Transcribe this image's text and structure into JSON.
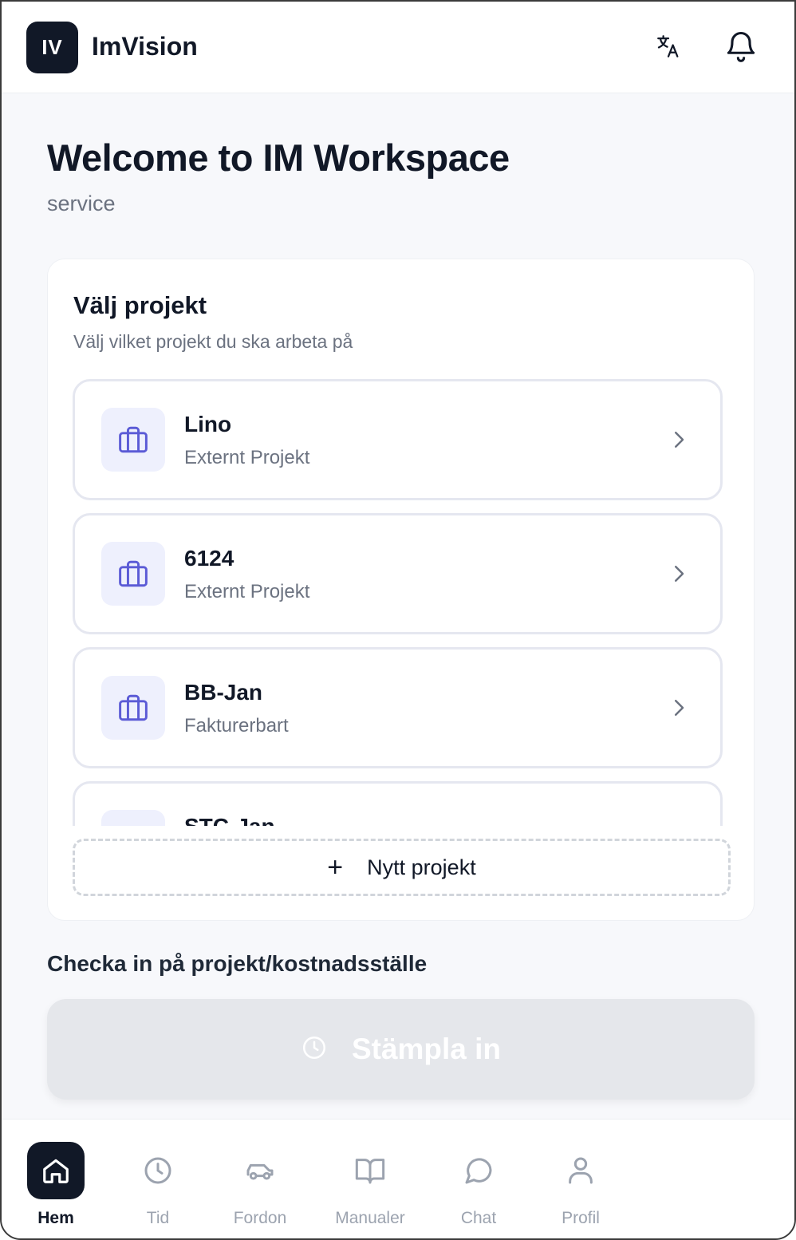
{
  "header": {
    "logo_text": "IV",
    "app_name": "ImVision"
  },
  "page": {
    "title": "Welcome to IM Workspace",
    "subtitle": "service"
  },
  "project_card": {
    "title": "Välj projekt",
    "subtitle": "Välj vilket projekt du ska arbeta på",
    "projects": [
      {
        "name": "Lino",
        "type": "Externt Projekt"
      },
      {
        "name": "6124",
        "type": "Externt Projekt"
      },
      {
        "name": "BB-Jan",
        "type": "Fakturerbart"
      },
      {
        "name": "STC-Jan",
        "type": ""
      }
    ],
    "new_project_label": "Nytt projekt"
  },
  "checkin": {
    "title": "Checka in på projekt/kostnadsställe",
    "stamp_label": "Stämpla in"
  },
  "nav": {
    "items": [
      {
        "label": "Hem",
        "icon": "home-icon",
        "active": true
      },
      {
        "label": "Tid",
        "icon": "clock-icon"
      },
      {
        "label": "Fordon",
        "icon": "car-icon"
      },
      {
        "label": "Manualer",
        "icon": "book-icon"
      },
      {
        "label": "Chat",
        "icon": "chat-icon"
      },
      {
        "label": "Profil",
        "icon": "user-icon"
      }
    ]
  },
  "colors": {
    "primary": "#111827",
    "accent": "#5b5bd6",
    "accent_bg": "#eef0fd",
    "muted": "#6b7280",
    "disabled": "#e5e7eb"
  }
}
